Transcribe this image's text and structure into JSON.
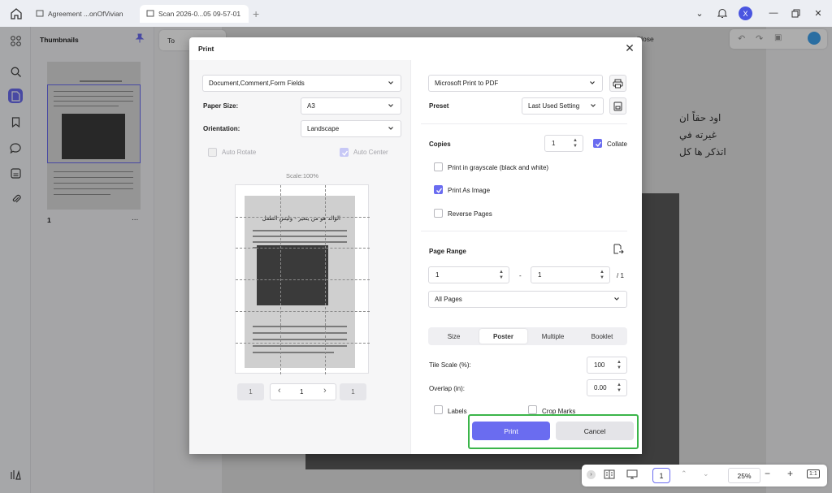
{
  "tabs": [
    {
      "label": "Agreement ...onOfVivian"
    },
    {
      "label": "Scan 2026-0...05 09-57-01"
    }
  ],
  "avatar_letter": "X",
  "thumbnails": {
    "title": "Thumbnails",
    "page_number": "1",
    "more": "..."
  },
  "toolbar": {
    "tools_label": "To",
    "close_label": "Close"
  },
  "document": {
    "line1": "اود حقاً ان",
    "line2": "غيرته في",
    "line3": "اتذكر ها كل"
  },
  "dialog": {
    "title": "Print",
    "content_select": "Document,Comment,Form Fields",
    "paper_size_label": "Paper Size:",
    "paper_size_value": "A3",
    "orientation_label": "Orientation:",
    "orientation_value": "Landscape",
    "auto_rotate_label": "Auto Rotate",
    "auto_center_label": "Auto Center",
    "scale_label": "Scale:100%",
    "preview_heading": "الوالد هو من يتغير - وليس الطفل",
    "pager": {
      "first": "1",
      "current": "1",
      "last": "1",
      "prev": "‹",
      "next": "›"
    },
    "printer_value": "Microsoft Print to PDF",
    "preset_label": "Preset",
    "preset_value": "Last Used Setting",
    "copies_label": "Copies",
    "copies_value": "1",
    "collate_label": "Collate",
    "grayscale_label": "Print in grayscale (black and white)",
    "print_as_image_label": "Print As Image",
    "reverse_pages_label": "Reverse Pages",
    "page_range_label": "Page Range",
    "range_from": "1",
    "range_to": "1",
    "range_dash": "-",
    "range_total": "/ 1",
    "pages_select": "All Pages",
    "modes": [
      {
        "label": "Size"
      },
      {
        "label": "Poster"
      },
      {
        "label": "Multiple"
      },
      {
        "label": "Booklet"
      }
    ],
    "tile_scale_label": "Tile Scale (%):",
    "tile_scale_value": "100",
    "overlap_label": "Overlap (in):",
    "overlap_value": "0.00",
    "labels_label": "Labels",
    "crop_marks_label": "Crop Marks",
    "print_button": "Print",
    "cancel_button": "Cancel"
  },
  "zoombar": {
    "page": "1",
    "zoom": "25%",
    "minus": "−",
    "plus": "+",
    "fit": "1:1"
  },
  "colors": {
    "accent": "#6a6cf0",
    "highlight": "#3bb54a"
  }
}
